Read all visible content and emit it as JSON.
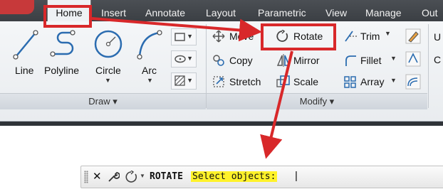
{
  "ribbon": {
    "tabs": [
      {
        "label": "Home",
        "active": true
      },
      {
        "label": "Insert"
      },
      {
        "label": "Annotate"
      },
      {
        "label": "Layout"
      },
      {
        "label": "Parametric"
      },
      {
        "label": "View"
      },
      {
        "label": "Manage"
      },
      {
        "label": "Out"
      }
    ],
    "draw_panel": {
      "title": "Draw ▾",
      "tools": [
        "Line",
        "Polyline",
        "Circle",
        "Arc"
      ]
    },
    "modify_panel": {
      "title": "Modify ▾",
      "tools": {
        "move": "Move",
        "rotate": "Rotate",
        "trim": "Trim",
        "copy": "Copy",
        "mirror": "Mirror",
        "fillet": "Fillet",
        "stretch": "Stretch",
        "scale": "Scale",
        "array": "Array"
      }
    },
    "overflow_letters": [
      "U",
      "C"
    ]
  },
  "command_line": {
    "command": "ROTATE",
    "prompt": "Select objects:",
    "cursor": "|"
  },
  "annotation": {
    "highlight_color": "#d8282a",
    "prompt_highlight_color": "#fff22a"
  },
  "colors": {
    "tab_bar": "#3f4348",
    "ribbon_bg": "#eef1f4",
    "icon_blue": "#2b6cb0"
  }
}
